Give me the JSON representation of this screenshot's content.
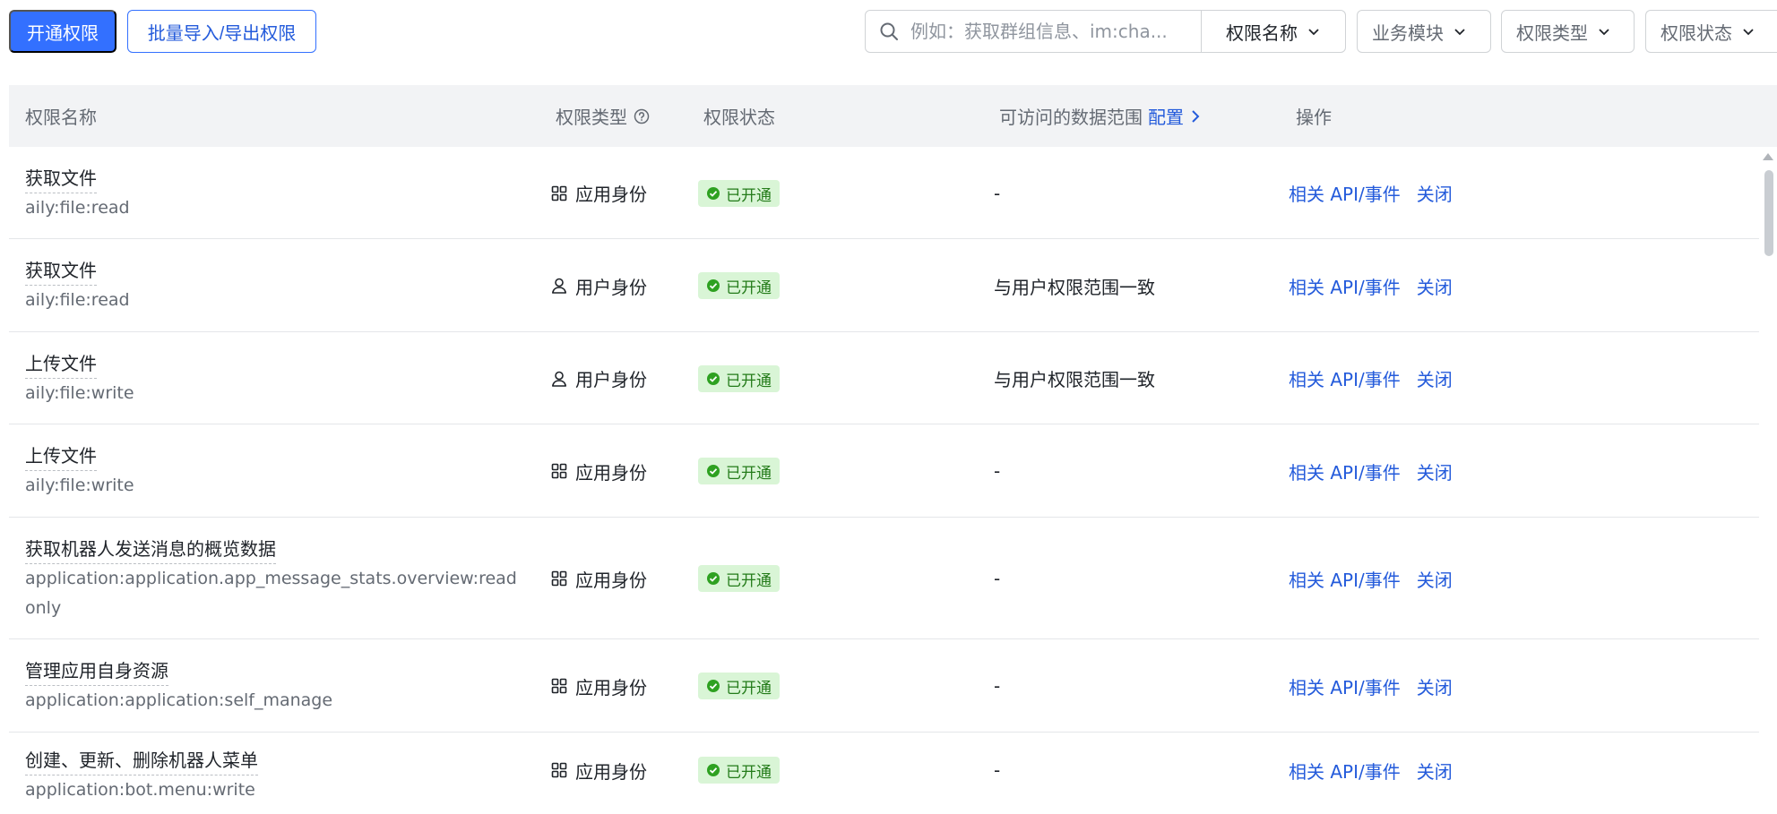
{
  "toolbar": {
    "enable_label": "开通权限",
    "batch_label": "批量导入/导出权限",
    "search_placeholder": "例如：获取群组信息、im:cha...",
    "search_field": "权限名称",
    "filters": {
      "module": "业务模块",
      "type": "权限类型",
      "status": "权限状态"
    }
  },
  "table": {
    "headers": {
      "name": "权限名称",
      "type": "权限类型",
      "status": "权限状态",
      "scope": "可访问的数据范围",
      "scope_config": "配置",
      "ops": "操作"
    },
    "rows": [
      {
        "title": "获取文件",
        "code": "aily:file:read",
        "type": "应用身份",
        "type_icon": "grid-icon",
        "status": "已开通",
        "scope": "-",
        "op_api": "相关 API/事件",
        "op_close": "关闭"
      },
      {
        "title": "获取文件",
        "code": "aily:file:read",
        "type": "用户身份",
        "type_icon": "user-icon",
        "status": "已开通",
        "scope": "与用户权限范围一致",
        "op_api": "相关 API/事件",
        "op_close": "关闭"
      },
      {
        "title": "上传文件",
        "code": "aily:file:write",
        "type": "用户身份",
        "type_icon": "user-icon",
        "status": "已开通",
        "scope": "与用户权限范围一致",
        "op_api": "相关 API/事件",
        "op_close": "关闭"
      },
      {
        "title": "上传文件",
        "code": "aily:file:write",
        "type": "应用身份",
        "type_icon": "grid-icon",
        "status": "已开通",
        "scope": "-",
        "op_api": "相关 API/事件",
        "op_close": "关闭"
      },
      {
        "title": "获取机器人发送消息的概览数据",
        "code": "application:application.app_message_stats.overview:readonly",
        "type": "应用身份",
        "type_icon": "grid-icon",
        "status": "已开通",
        "scope": "-",
        "op_api": "相关 API/事件",
        "op_close": "关闭"
      },
      {
        "title": "管理应用自身资源",
        "code": "application:application:self_manage",
        "type": "应用身份",
        "type_icon": "grid-icon",
        "status": "已开通",
        "scope": "-",
        "op_api": "相关 API/事件",
        "op_close": "关闭"
      },
      {
        "title": "创建、更新、删除机器人菜单",
        "code": "application:bot.menu:write",
        "type": "应用身份",
        "type_icon": "grid-icon",
        "status": "已开通",
        "scope": "-",
        "op_api": "相关 API/事件",
        "op_close": "关闭"
      }
    ]
  },
  "colors": {
    "primary": "#3370ff",
    "link": "#245bdb",
    "status_bg": "#d9f5d6",
    "status_text": "#237b19",
    "header_bg": "#f2f3f5"
  }
}
